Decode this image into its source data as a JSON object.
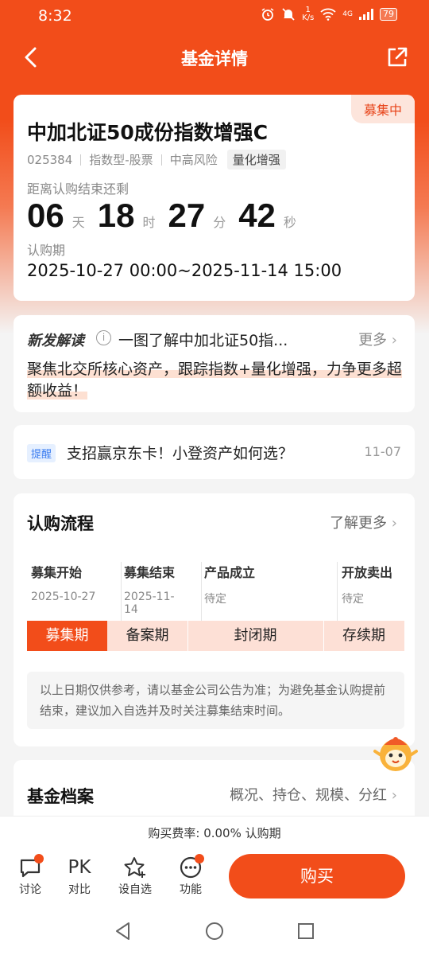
{
  "status_bar": {
    "time": "8:32",
    "net_speed": "1\nK/s",
    "signal": "4G",
    "battery": "79"
  },
  "header": {
    "title": "基金详情"
  },
  "fund": {
    "status_badge": "募集中",
    "name": "中加北证50成份指数增强C",
    "code": "025384",
    "type": "指数型-股票",
    "risk": "中高风险",
    "tag": "量化增强",
    "countdown_label": "距离认购结束还剩",
    "countdown": {
      "days": "06",
      "days_unit": "天",
      "hours": "18",
      "hours_unit": "时",
      "minutes": "27",
      "minutes_unit": "分",
      "seconds": "42",
      "seconds_unit": "秒"
    },
    "period_label": "认购期",
    "period_value": "2025-10-27 00:00~2025-11-14 15:00"
  },
  "news": {
    "label": "新发解读",
    "title": "一图了解中加北证50指...",
    "more": "更多",
    "highlight": "聚焦北交所核心资产，跟踪指数+量化增强，力争更多超额收益！"
  },
  "reminder": {
    "badge": "提醒",
    "text": "支招赢京东卡！小登资产如何选？",
    "date": "11-07"
  },
  "process": {
    "title": "认购流程",
    "learn_more": "了解更多",
    "steps": [
      {
        "label": "募集开始",
        "date": "2025-10-27"
      },
      {
        "label": "募集结束",
        "date": "2025-11-14"
      },
      {
        "label": "产品成立",
        "date": "待定"
      },
      {
        "label": "开放卖出",
        "date": "待定"
      }
    ],
    "phases": [
      "募集期",
      "备案期",
      "封闭期",
      "存续期"
    ],
    "note": "以上日期仅供参考，请以基金公司公告为准；为避免基金认购提前结束，建议加入自选并及时关注募集结束时间。"
  },
  "archive": {
    "title": "基金档案",
    "links": "概况、持仓、规模、分红"
  },
  "fee": {
    "text": "购买费率: 0.00% 认购期"
  },
  "toolbar": {
    "items": [
      {
        "label": "讨论",
        "icon": "chat-icon"
      },
      {
        "label": "对比",
        "icon_text": "PK"
      },
      {
        "label": "设自选",
        "icon": "star-add-icon"
      },
      {
        "label": "功能",
        "icon": "more-icon"
      }
    ],
    "buy_label": "购买"
  },
  "colors": {
    "brand": "#f24d1a",
    "badge_bg": "#fde5dc",
    "remind_blue": "#3a7cf0"
  }
}
